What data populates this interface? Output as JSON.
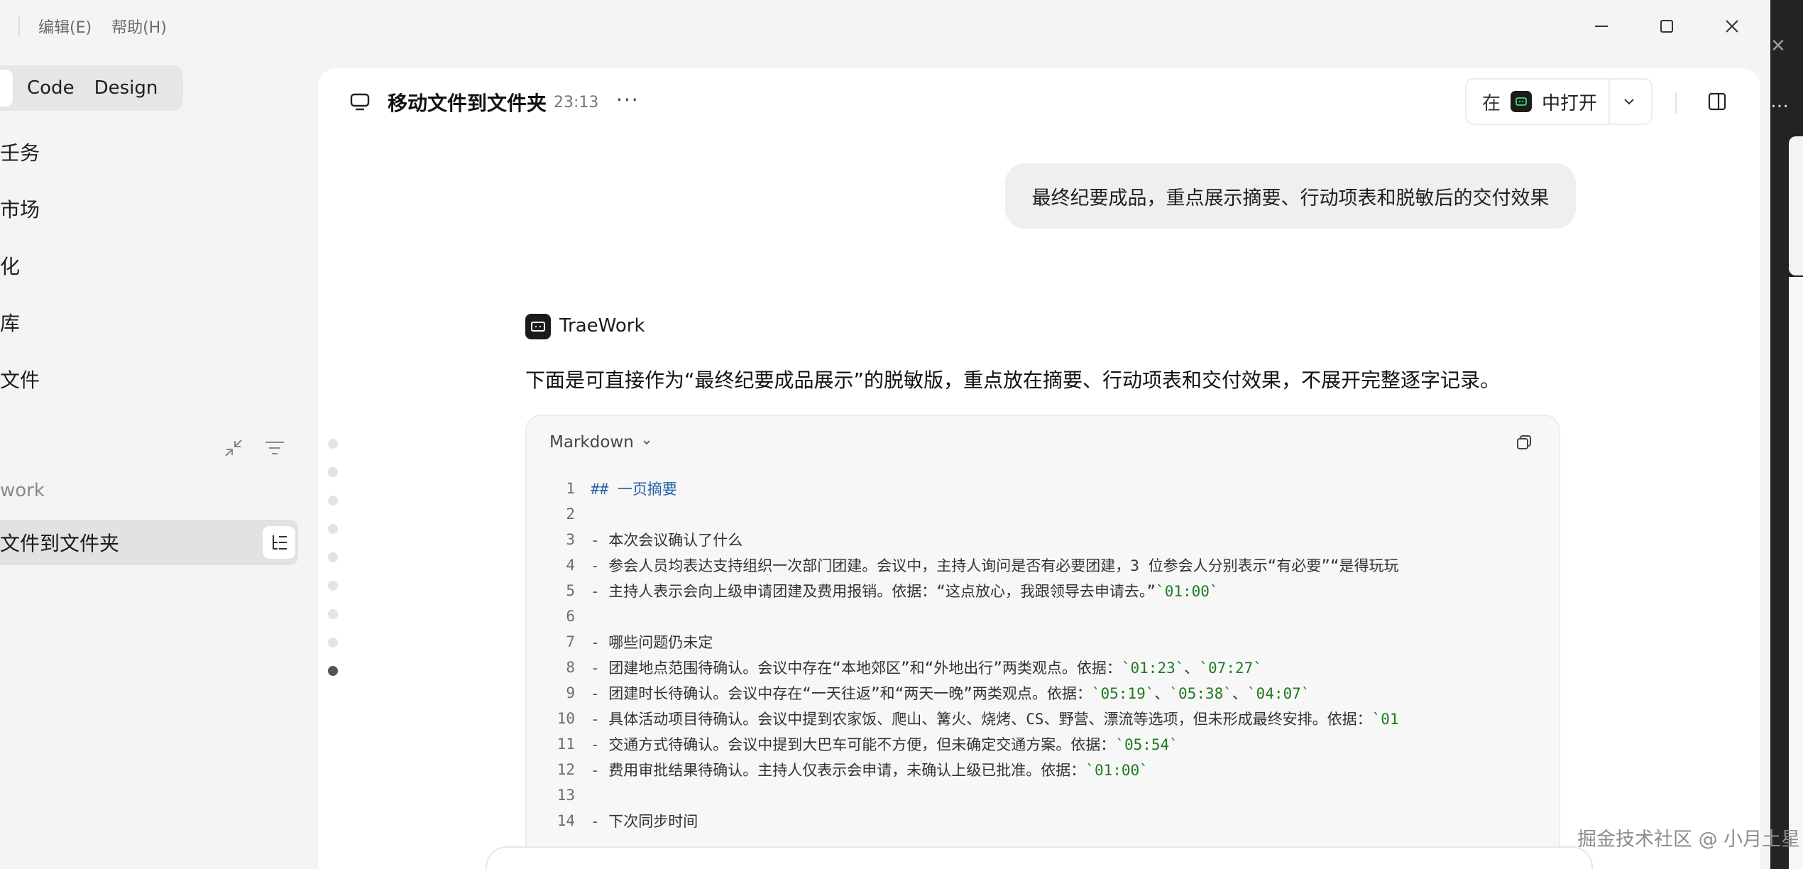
{
  "menu": {
    "items": [
      "编辑(E)",
      "帮助(H)"
    ]
  },
  "sidebar": {
    "mode_tabs": [
      "Code",
      "Design"
    ],
    "nav": [
      "壬务",
      "市场",
      "化",
      "库",
      "文件"
    ],
    "section_label": "work",
    "chat_item": "文件到文件夹"
  },
  "header": {
    "title": "移动文件到文件夹",
    "time": "23:13",
    "more": "···",
    "open_in_prefix": "在",
    "open_in_label": "中打开"
  },
  "conversation": {
    "user_message": "最终纪要成品，重点展示摘要、行动项表和脱敏后的交付效果",
    "assistant_name": "TraeWork",
    "assistant_intro": "下面是可直接作为“最终纪要成品展示”的脱敏版，重点放在摘要、行动项表和交付效果，不展开完整逐字记录。"
  },
  "code_block": {
    "language": "Markdown",
    "lines": [
      {
        "n": "1",
        "parts": [
          {
            "t": "## 一页摘要",
            "c": "h"
          }
        ]
      },
      {
        "n": "2",
        "parts": []
      },
      {
        "n": "3",
        "parts": [
          {
            "t": "- ",
            "c": "dash"
          },
          {
            "t": "本次会议确认了什么",
            "c": ""
          }
        ]
      },
      {
        "n": "4",
        "parts": [
          {
            "t": "  - ",
            "c": "dash"
          },
          {
            "t": "参会人员均表达支持组织一次部门团建。会议中，主持人询问是否有必要团建，3 位参会人分别表示“有必要”“是得玩玩",
            "c": ""
          }
        ]
      },
      {
        "n": "5",
        "parts": [
          {
            "t": "  - ",
            "c": "dash"
          },
          {
            "t": "主持人表示会向上级申请团建及费用报销。依据：“这点放心，我跟领导去申请去。”",
            "c": ""
          },
          {
            "t": "`01:00`",
            "c": "code"
          }
        ]
      },
      {
        "n": "6",
        "parts": []
      },
      {
        "n": "7",
        "parts": [
          {
            "t": "- ",
            "c": "dash"
          },
          {
            "t": "哪些问题仍未定",
            "c": ""
          }
        ]
      },
      {
        "n": "8",
        "parts": [
          {
            "t": "  - ",
            "c": "dash"
          },
          {
            "t": "团建地点范围待确认。会议中存在“本地郊区”和“外地出行”两类观点。依据：",
            "c": ""
          },
          {
            "t": "`01:23`",
            "c": "code"
          },
          {
            "t": "、",
            "c": ""
          },
          {
            "t": "`07:27`",
            "c": "code"
          }
        ]
      },
      {
        "n": "9",
        "parts": [
          {
            "t": "  - ",
            "c": "dash"
          },
          {
            "t": "团建时长待确认。会议中存在“一天往返”和“两天一晚”两类观点。依据：",
            "c": ""
          },
          {
            "t": "`05:19`",
            "c": "code"
          },
          {
            "t": "、",
            "c": ""
          },
          {
            "t": "`05:38`",
            "c": "code"
          },
          {
            "t": "、",
            "c": ""
          },
          {
            "t": "`04:07`",
            "c": "code"
          }
        ]
      },
      {
        "n": "10",
        "parts": [
          {
            "t": "  - ",
            "c": "dash"
          },
          {
            "t": "具体活动项目待确认。会议中提到农家饭、爬山、篝火、烧烤、CS、野营、漂流等选项，但未形成最终安排。依据：",
            "c": ""
          },
          {
            "t": "`01",
            "c": "code"
          }
        ]
      },
      {
        "n": "11",
        "parts": [
          {
            "t": "  - ",
            "c": "dash"
          },
          {
            "t": "交通方式待确认。会议中提到大巴车可能不方便，但未确定交通方案。依据：",
            "c": ""
          },
          {
            "t": "`05:54`",
            "c": "code"
          }
        ]
      },
      {
        "n": "12",
        "parts": [
          {
            "t": "  - ",
            "c": "dash"
          },
          {
            "t": "费用审批结果待确认。主持人仅表示会申请，未确认上级已批准。依据：",
            "c": ""
          },
          {
            "t": "`01:00`",
            "c": "code"
          }
        ]
      },
      {
        "n": "13",
        "parts": []
      },
      {
        "n": "14",
        "parts": [
          {
            "t": "- ",
            "c": "dash"
          },
          {
            "t": "下次同步时间",
            "c": ""
          }
        ]
      }
    ]
  },
  "watermark": "掘金技术社区 @ 小月土星",
  "icons": {
    "minimize": "minimize-icon",
    "maximize": "maximize-icon",
    "close": "close-icon",
    "collapse": "collapse-icon",
    "filter": "filter-icon",
    "outline": "outline-list-icon",
    "monitor": "monitor-icon",
    "chevron": "chevron-down-icon",
    "panel": "panel-toggle-icon",
    "copy": "copy-icon",
    "app": "app-logo-icon"
  },
  "colors": {
    "accent_heading": "#2563a8",
    "code_token": "#1f7a1f",
    "app_logo": "#1b1b1b",
    "app_logo_glyph": "#3ddc84"
  }
}
